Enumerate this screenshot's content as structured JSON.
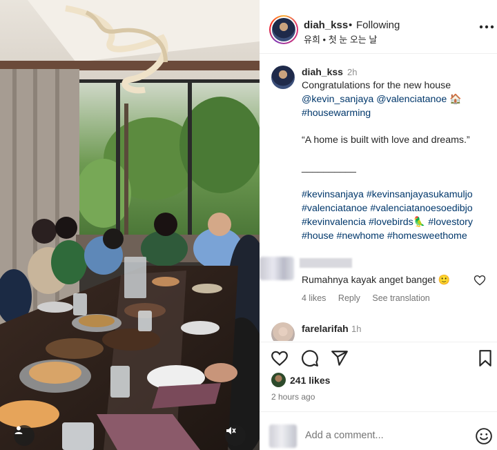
{
  "post": {
    "username": "diah_kss",
    "dot": "•",
    "follow_status": "Following",
    "audio": "유희 • 첫 눈 오는 날"
  },
  "caption": {
    "username": "diah_kss",
    "time": "2h",
    "lines": [
      {
        "text": "Congratulations for the new house",
        "link": false
      },
      {
        "text": "@kevin_sanjaya @valenciatanoe 🏠",
        "link": true
      },
      {
        "text": "#housewarming",
        "link": true
      },
      {
        "text": "",
        "link": false
      },
      {
        "text": "“A home is built with love and dreams.”",
        "link": false
      },
      {
        "text": "",
        "link": false
      },
      {
        "text": "__________",
        "link": false
      },
      {
        "text": "",
        "link": false
      },
      {
        "text": "#kevinsanjaya #kevinsanjayasukamuljo",
        "link": true
      },
      {
        "text": "#valenciatanoe #valenciatanoesoedibjo",
        "link": true
      },
      {
        "text": "#kevinvalencia #lovebirds🦜 #lovestory",
        "link": true
      },
      {
        "text": "#house #newhome #homesweethome",
        "link": true
      }
    ]
  },
  "comments": [
    {
      "text": "Rumahnya kayak anget banget 🙂",
      "likes": "4 likes",
      "reply": "Reply",
      "see_translation": "See translation"
    },
    {
      "username": "farelarifah",
      "time": "1h"
    }
  ],
  "stats": {
    "likes": "241 likes",
    "time_ago": "2 hours ago"
  },
  "comment_box": {
    "placeholder": "Add a comment..."
  },
  "icons": {
    "more": "more-options-icon",
    "like": "heart-icon",
    "comment": "comment-icon",
    "share": "share-icon",
    "save": "bookmark-icon",
    "emoji": "emoji-icon",
    "tags": "user-tag-icon",
    "mute": "muted-speaker-icon"
  },
  "colors": {
    "link": "#00376b",
    "muted_text": "#8e8e8e",
    "border": "#efefef"
  }
}
